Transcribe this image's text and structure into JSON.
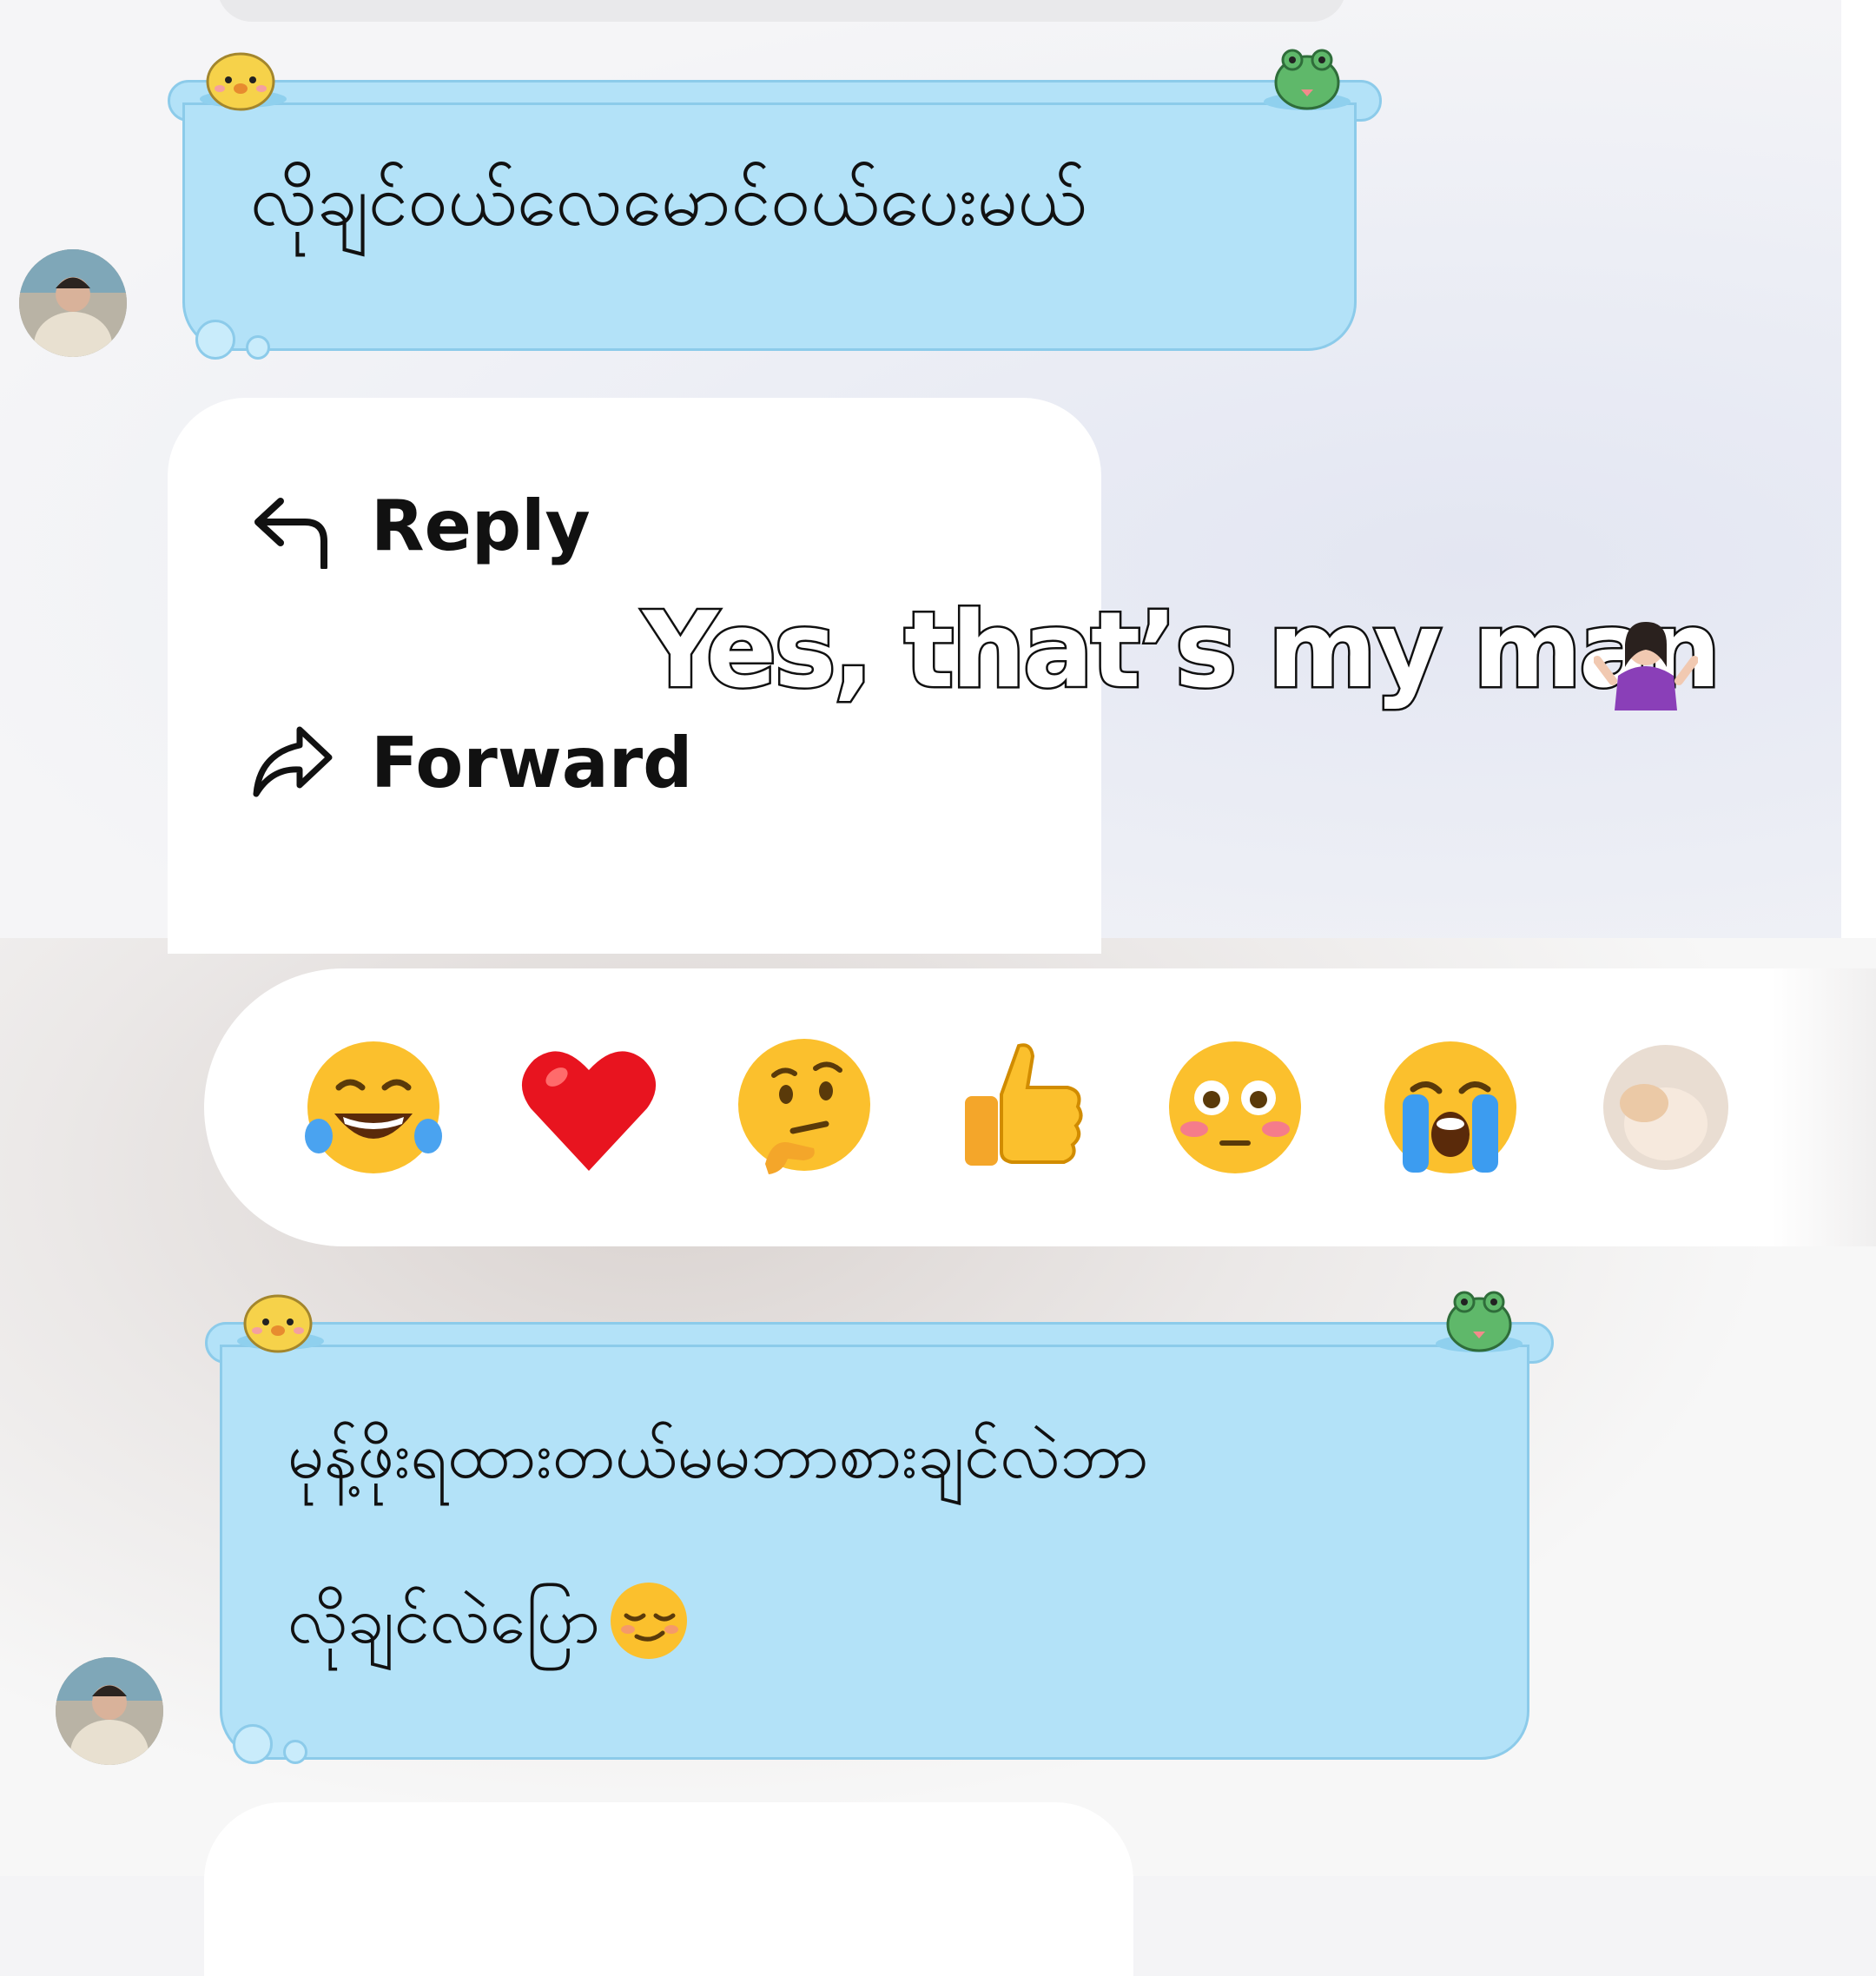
{
  "context_menu": {
    "reply_label": "Reply",
    "forward_label": "Forward"
  },
  "overlay_caption": "Yes, that’s my man",
  "messages": [
    {
      "sender": "contact",
      "text": "လိုချင်ဝယ်လေမောင်ဝယ်ပေးမယ်"
    },
    {
      "sender": "contact",
      "line1": "မုန့်ဖိုးရထားတယ်မမဘာစားချင်လဲဘာ",
      "line2": "လိုချင်လဲပြော"
    }
  ],
  "reactions": [
    {
      "name": "laughing-tears",
      "glyph": "😂"
    },
    {
      "name": "red-heart",
      "glyph": "❤"
    },
    {
      "name": "thinking-face",
      "glyph": "🤔"
    },
    {
      "name": "thumbs-up",
      "glyph": "👍"
    },
    {
      "name": "flushed-face",
      "glyph": "😳"
    },
    {
      "name": "crying-face",
      "glyph": "😭"
    },
    {
      "name": "see-no-evil-monkey",
      "glyph": "🙈"
    }
  ],
  "colors": {
    "bubble_fill": "#b3e2f8",
    "bubble_border": "#8ccbea",
    "menu_bg": "#ffffff",
    "caption_stroke": "#111111"
  }
}
